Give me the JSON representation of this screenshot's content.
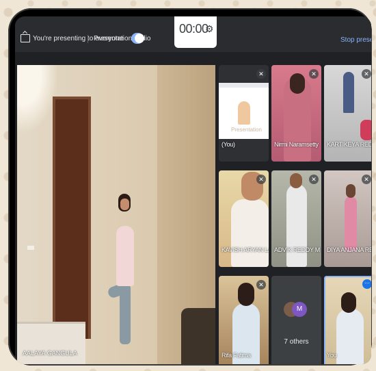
{
  "topbar": {
    "presenting_text": "You're presenting to everyone",
    "audio_label": "Presentation audio",
    "timer": "00:00",
    "stop_label": "Stop presenti"
  },
  "main_speaker": {
    "name": "AALAYA GANGULA"
  },
  "tiles": [
    {
      "name": "(You)",
      "kind": "presentation",
      "presentation_title": "Presentation"
    },
    {
      "name": "Nirmi Naramsetty",
      "kind": "camera"
    },
    {
      "name": "KARTIKEYA REDDY G...",
      "kind": "camera"
    },
    {
      "name": "KAVISH ARYAN LANKA",
      "kind": "camera"
    },
    {
      "name": "ADVIK REDDY M",
      "kind": "camera"
    },
    {
      "name": "DIYA ANJANA REDDY...",
      "kind": "camera"
    },
    {
      "name": "Rifa Fatima",
      "kind": "camera"
    },
    {
      "name": "7 others",
      "kind": "others",
      "avatar_letter": "M"
    },
    {
      "name": "You",
      "kind": "self"
    }
  ],
  "icons": {
    "present": "present-to-all-icon",
    "toggle": "toggle-switch",
    "timer_settings": "gear-icon",
    "mute": "mic-off-icon",
    "more": "more-options-icon"
  },
  "colors": {
    "accent": "#8ab4f8",
    "background": "#202124",
    "avatar": "#7e57c2"
  }
}
